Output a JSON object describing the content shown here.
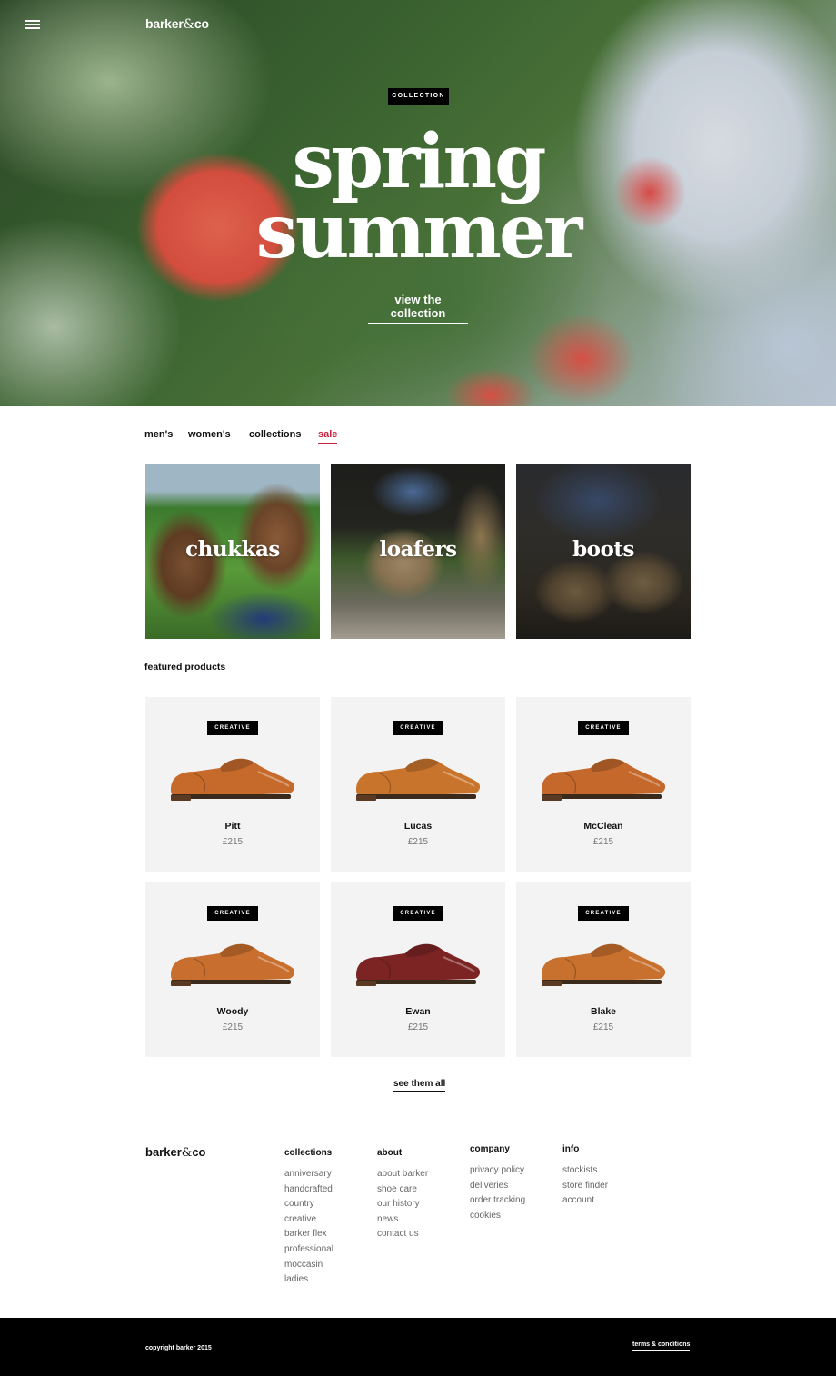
{
  "brand": {
    "name": "barker",
    "amp": "&",
    "suffix": "co"
  },
  "hero": {
    "tag": "COLLECTION",
    "title_line1": "spring",
    "title_line2": "summer",
    "cta": "view the collection"
  },
  "nav": {
    "mens": "men's",
    "womens": "women's",
    "collections": "collections",
    "sale": "sale"
  },
  "categories": [
    {
      "label": "chukkas"
    },
    {
      "label": "loafers"
    },
    {
      "label": "boots"
    }
  ],
  "featured": {
    "title": "featured products",
    "products": [
      {
        "badge": "CREATIVE",
        "name": "Pitt",
        "price": "£215",
        "color": "#c66a2c"
      },
      {
        "badge": "CREATIVE",
        "name": "Lucas",
        "price": "£215",
        "color": "#c8742c"
      },
      {
        "badge": "CREATIVE",
        "name": "McClean",
        "price": "£215",
        "color": "#c4682c"
      },
      {
        "badge": "CREATIVE",
        "name": "Woody",
        "price": "£215",
        "color": "#c86e2e"
      },
      {
        "badge": "CREATIVE",
        "name": "Ewan",
        "price": "£215",
        "color": "#7c2424"
      },
      {
        "badge": "CREATIVE",
        "name": "Blake",
        "price": "£215",
        "color": "#c8702e"
      }
    ],
    "see_all": "see them all"
  },
  "footer": {
    "columns": [
      {
        "heading": "collections",
        "links": [
          "anniversary",
          "handcrafted",
          "country",
          "creative",
          "barker flex",
          "professional",
          "moccasin",
          "ladies"
        ]
      },
      {
        "heading": "about",
        "links": [
          "about barker",
          "shoe care",
          "our history",
          "news",
          "contact us"
        ]
      },
      {
        "heading": "company",
        "links": [
          "privacy policy",
          "deliveries",
          "order tracking",
          "cookies"
        ]
      },
      {
        "heading": "info",
        "links": [
          "stockists",
          "store finder",
          "account"
        ]
      }
    ],
    "copyright": "copyright barker 2015",
    "terms": "terms & conditions"
  }
}
